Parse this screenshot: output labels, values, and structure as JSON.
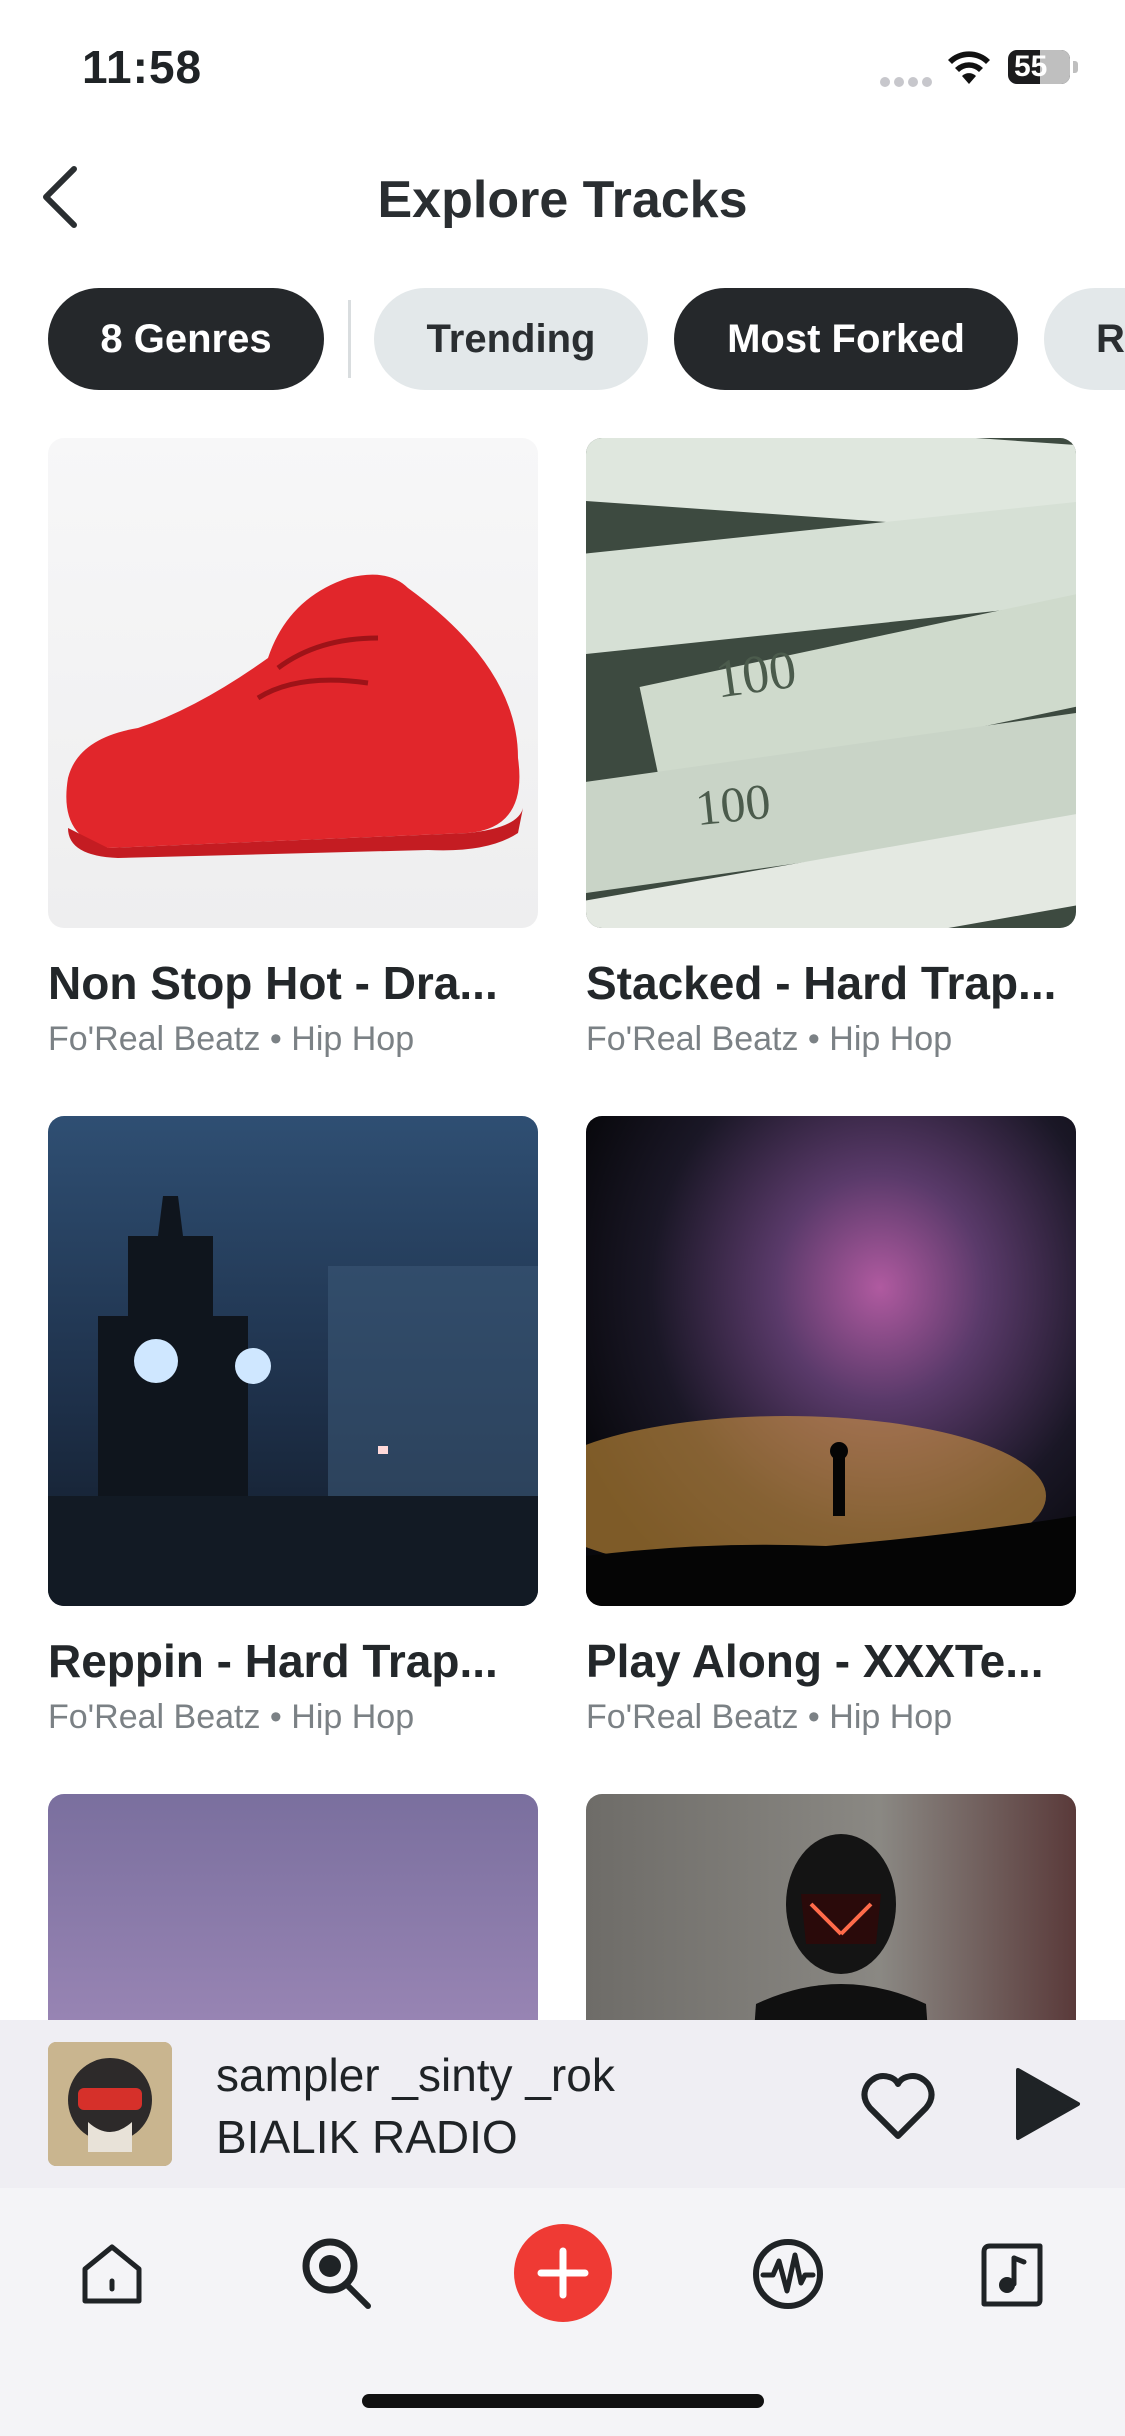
{
  "status": {
    "time": "11:58",
    "battery": "55"
  },
  "header": {
    "title": "Explore Tracks"
  },
  "chips": [
    {
      "label": "8 Genres",
      "selected": true
    },
    {
      "label": "Trending",
      "selected": false
    },
    {
      "label": "Most Forked",
      "selected": true
    },
    {
      "label": "Re",
      "selected": false
    }
  ],
  "cards": [
    {
      "title": "Non Stop Hot - Dra...",
      "artist": "Fo'Real Beatz",
      "genre": "Hip Hop",
      "image": "red-sneaker"
    },
    {
      "title": "Stacked - Hard Trap...",
      "artist": "Fo'Real Beatz",
      "genre": "Hip Hop",
      "image": "dollar-bills"
    },
    {
      "title": "Reppin - Hard Trap...",
      "artist": "Fo'Real Beatz",
      "genre": "Hip Hop",
      "image": "clock-tower-night"
    },
    {
      "title": "Play Along - XXXTe...",
      "artist": "Fo'Real Beatz",
      "genre": "Hip Hop",
      "image": "milky-way-silhouette"
    },
    {
      "title": "",
      "artist": "",
      "genre": "",
      "image": "purple-clouds"
    },
    {
      "title": "",
      "artist": "",
      "genre": "",
      "image": "masked-person"
    }
  ],
  "mini_player": {
    "title": "sampler _sinty _rok",
    "artist": "BIALIK RADIO",
    "art": "masked-character-avatar"
  },
  "tabs": [
    "home-icon",
    "search-icon",
    "add-icon",
    "waveform-icon",
    "music-library-icon"
  ],
  "colors": {
    "accent": "#ef3a34",
    "chip_dark": "#25282b",
    "chip_light": "#e3e8ea"
  }
}
